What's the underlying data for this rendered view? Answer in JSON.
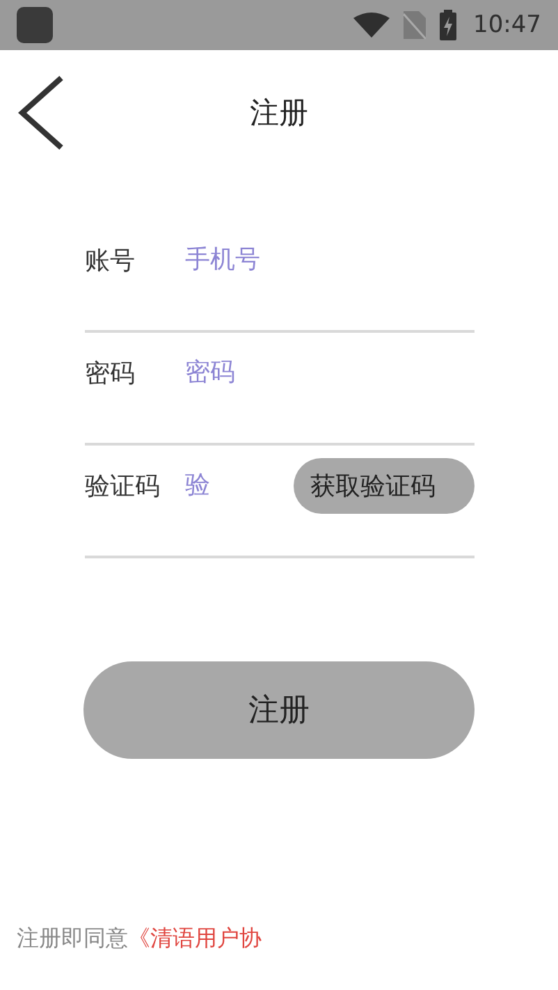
{
  "status_bar": {
    "time": "10:47"
  },
  "header": {
    "title": "注册"
  },
  "fields": [
    {
      "label": "账号",
      "placeholder": "手机号",
      "kind": "text"
    },
    {
      "label": "密码",
      "placeholder": "密码",
      "kind": "text"
    },
    {
      "label": "验证码",
      "placeholder": "验",
      "kind": "code",
      "button": "获取验证码"
    }
  ],
  "submit": "注册",
  "agreement": {
    "prefix": "注册即同意",
    "link": "《清语用户协"
  }
}
